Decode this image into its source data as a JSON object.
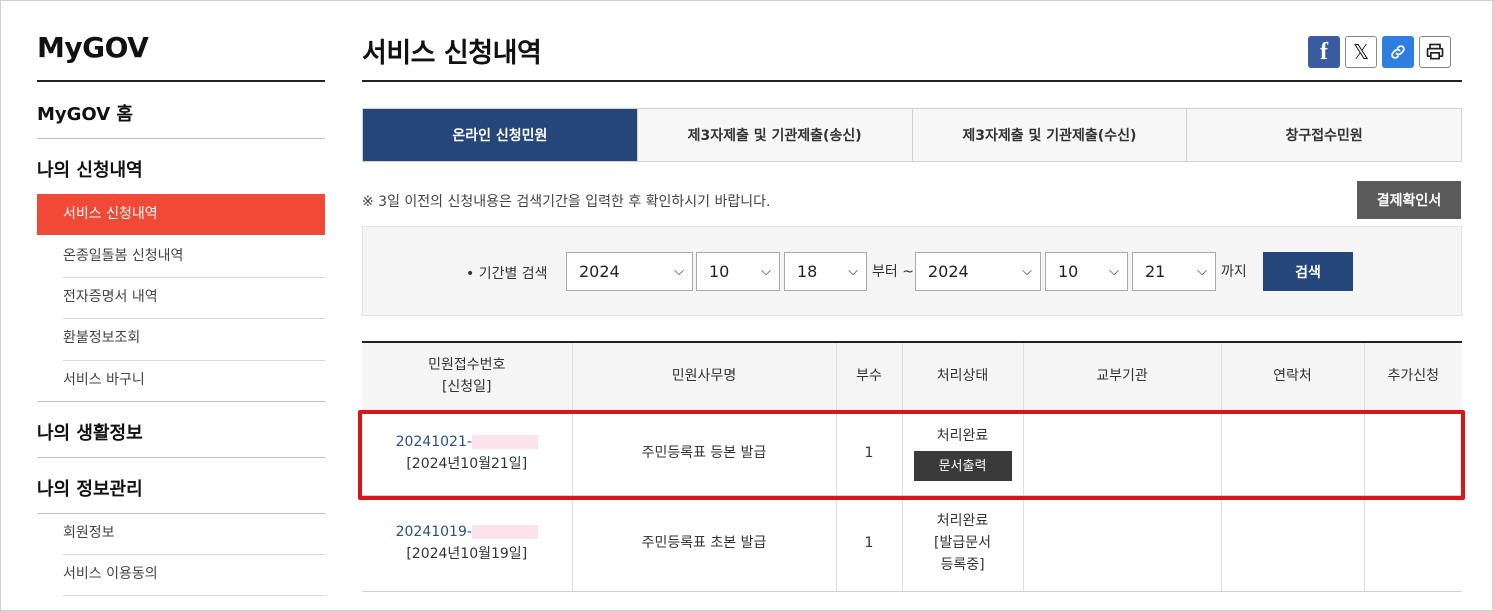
{
  "sidebar": {
    "brand": "MyGOV",
    "home": "MyGOV 홈",
    "section_apps": "나의 신청내역",
    "apps_items": [
      "서비스 신청내역",
      "온종일돌봄 신청내역",
      "전자증명서 내역",
      "환불정보조회",
      "서비스 바구니"
    ],
    "section_life": "나의 생활정보",
    "section_info": "나의 정보관리",
    "info_items": [
      "회원정보",
      "서비스 이용동의"
    ]
  },
  "main": {
    "title": "서비스 신청내역",
    "share": {
      "facebook": "f",
      "x": "𝕏",
      "link": "🔗"
    },
    "tabs": [
      "온라인 신청민원",
      "제3자제출 및 기관제출(송신)",
      "제3자제출 및 기관제출(수신)",
      "창구접수민원"
    ],
    "notice": "※ 3일 이전의 신청내용은 검색기간을 입력한 후 확인하시기 바랍니다.",
    "payment_button": "결제확인서",
    "search": {
      "label": "• 기간별 검색",
      "from_year": "2024",
      "from_month": "10",
      "from_day": "18",
      "from_text": "부터 ~",
      "to_year": "2024",
      "to_month": "10",
      "to_day": "21",
      "to_text": "까지",
      "button": "검색"
    },
    "table": {
      "headers": {
        "receipt_line1": "민원접수번호",
        "receipt_line2": "[신청일]",
        "service": "민원사무명",
        "copies": "부수",
        "status": "처리상태",
        "agency": "교부기관",
        "contact": "연락처",
        "extra": "추가신청"
      },
      "rows": [
        {
          "receipt": "20241021-",
          "date": "[2024년10월21일]",
          "service": "주민등록표 등본 발급",
          "copies": "1",
          "status": "처리완료",
          "action": "문서출력"
        },
        {
          "receipt": "20241019-",
          "date": "[2024년10월19일]",
          "service": "주민등록표 초본 발급",
          "copies": "1",
          "status": "처리완료",
          "status_line2": "[발급문서",
          "status_line3": "등록중]"
        }
      ]
    }
  },
  "colors": {
    "active_menu": "#f04a36",
    "navy": "#25467a",
    "highlight": "#d9151b"
  }
}
